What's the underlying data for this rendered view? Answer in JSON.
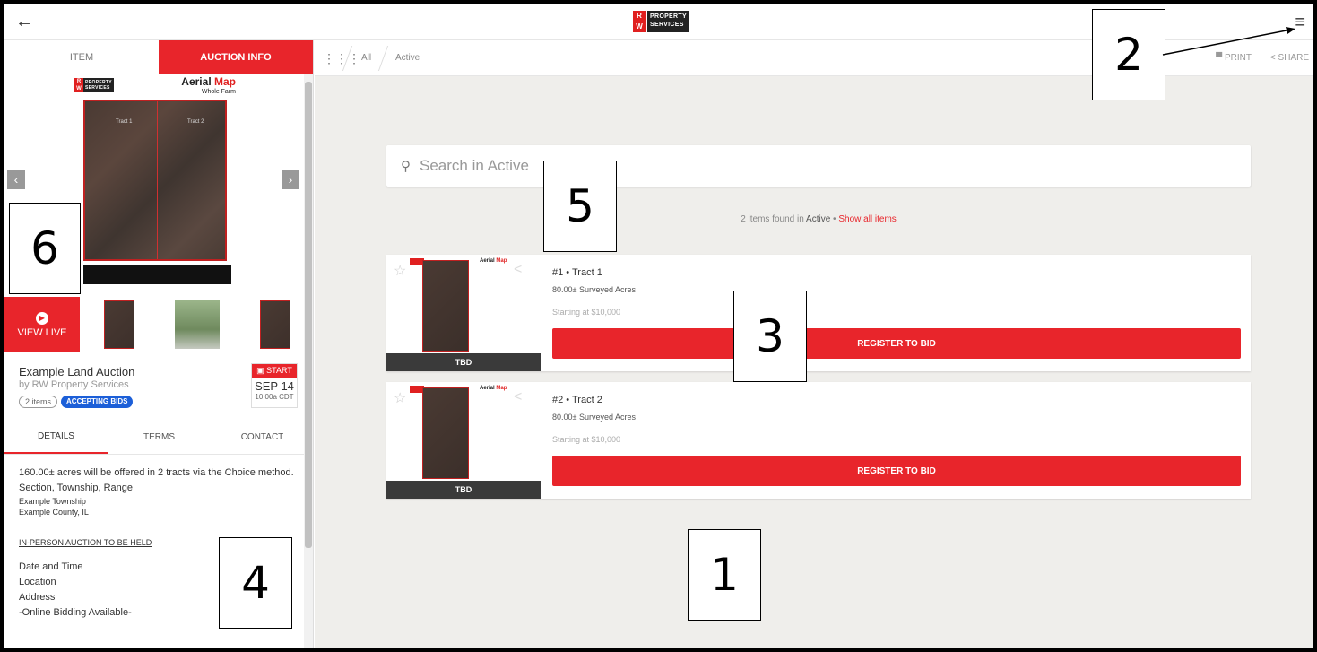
{
  "header": {
    "back_label": "←",
    "logo_mark": "R W",
    "logo_text_1": "PROPERTY",
    "logo_text_2": "SERVICES",
    "menu_label": "≡"
  },
  "left_tabs": [
    {
      "label": "ITEM"
    },
    {
      "label": "AUCTION INFO"
    }
  ],
  "hero": {
    "map_title_1": "Aerial",
    "map_title_2": "Map",
    "map_subtitle": "Whole Farm",
    "tract1": "Tract 1",
    "tract2": "Tract 2",
    "prev": "‹",
    "next": "›"
  },
  "thumbs": {
    "view_live": "VIEW LIVE"
  },
  "auction": {
    "title": "Example Land Auction",
    "by": "by RW Property Services",
    "item_count": "2 items",
    "status": "ACCEPTING BIDS",
    "start_label": "START",
    "start_date": "SEP 14",
    "start_time": "10:00a CDT"
  },
  "detail_tabs": [
    {
      "label": "DETAILS"
    },
    {
      "label": "TERMS"
    },
    {
      "label": "CONTACT"
    }
  ],
  "details": {
    "line1": "160.00± acres will be offered in 2 tracts via the Choice method.",
    "line2": "Section, Township, Range",
    "line3": "Example Township",
    "line4": "Example County, IL",
    "heading": "IN-PERSON AUCTION TO BE HELD",
    "line5": "Date and Time",
    "line6": "Location",
    "line7": "Address",
    "line8": "-Online Bidding Available-"
  },
  "crumbs": {
    "all": "All",
    "active": "Active",
    "print": "PRINT",
    "share": "SHARE"
  },
  "search": {
    "placeholder": "Search in Active"
  },
  "results": {
    "count_text": "2 items found in",
    "scope": "Active",
    "separator": "•",
    "show_all": "Show all items"
  },
  "items": [
    {
      "title": "#1 • Tract 1",
      "acres": "80.00± Surveyed Acres",
      "price": "Starting at $10,000",
      "button": "REGISTER TO BID",
      "tbd": "TBD",
      "map_title_1": "Aerial",
      "map_title_2": "Map"
    },
    {
      "title": "#2 • Tract 2",
      "acres": "80.00± Surveyed Acres",
      "price": "Starting at $10,000",
      "button": "REGISTER TO BID",
      "tbd": "TBD",
      "map_title_1": "Aerial",
      "map_title_2": "Map"
    }
  ],
  "annotations": [
    "1",
    "2",
    "3",
    "4",
    "5",
    "6"
  ],
  "colors": {
    "accent": "#e8252b",
    "badge_blue": "#1c5fd8",
    "background": "#efeeeb"
  }
}
